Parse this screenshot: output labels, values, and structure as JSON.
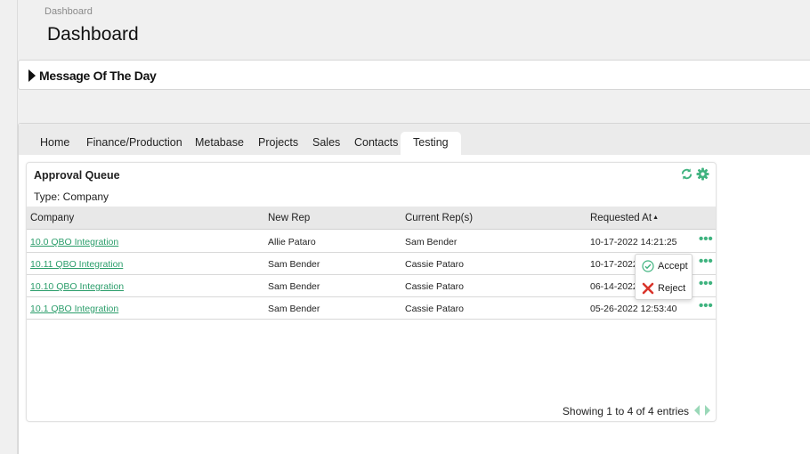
{
  "breadcrumb": "Dashboard",
  "page_title": "Dashboard",
  "motd": {
    "label": "Message Of The Day",
    "icon": "caret-right-icon"
  },
  "tabs": [
    {
      "label": "Home"
    },
    {
      "label": "Finance/Production"
    },
    {
      "label": "Metabase"
    },
    {
      "label": "Projects"
    },
    {
      "label": "Sales"
    },
    {
      "label": "Contacts"
    },
    {
      "label": "Testing",
      "active": true
    }
  ],
  "widget": {
    "title": "Approval Queue",
    "type_label": "Type: Company",
    "icons": [
      "refresh-icon",
      "gear-icon"
    ],
    "columns": [
      "Company",
      "New Rep",
      "Current Rep(s)",
      "Requested At"
    ],
    "rows": [
      {
        "company": "10.0 QBO Integration",
        "new_rep": "Allie Pataro",
        "current_rep": "Sam Bender",
        "requested_at": "10-17-2022 14:21:25"
      },
      {
        "company": "10.11 QBO Integration",
        "new_rep": "Sam Bender",
        "current_rep": "Cassie Pataro",
        "requested_at": "10-17-2022"
      },
      {
        "company": "10.10 QBO Integration",
        "new_rep": "Sam Bender",
        "current_rep": "Cassie Pataro",
        "requested_at": "06-14-2022"
      },
      {
        "company": "10.1 QBO Integration",
        "new_rep": "Sam Bender",
        "current_rep": "Cassie Pataro",
        "requested_at": "05-26-2022 12:53:40"
      }
    ],
    "row_actions_label": "•••",
    "footer": "Showing 1 to 4 of 4 entries"
  },
  "popup": {
    "accept_label": "Accept",
    "reject_label": "Reject"
  },
  "colors": {
    "accent": "#3fb37f",
    "link": "#2a9d6a",
    "reject": "#d9342b"
  }
}
